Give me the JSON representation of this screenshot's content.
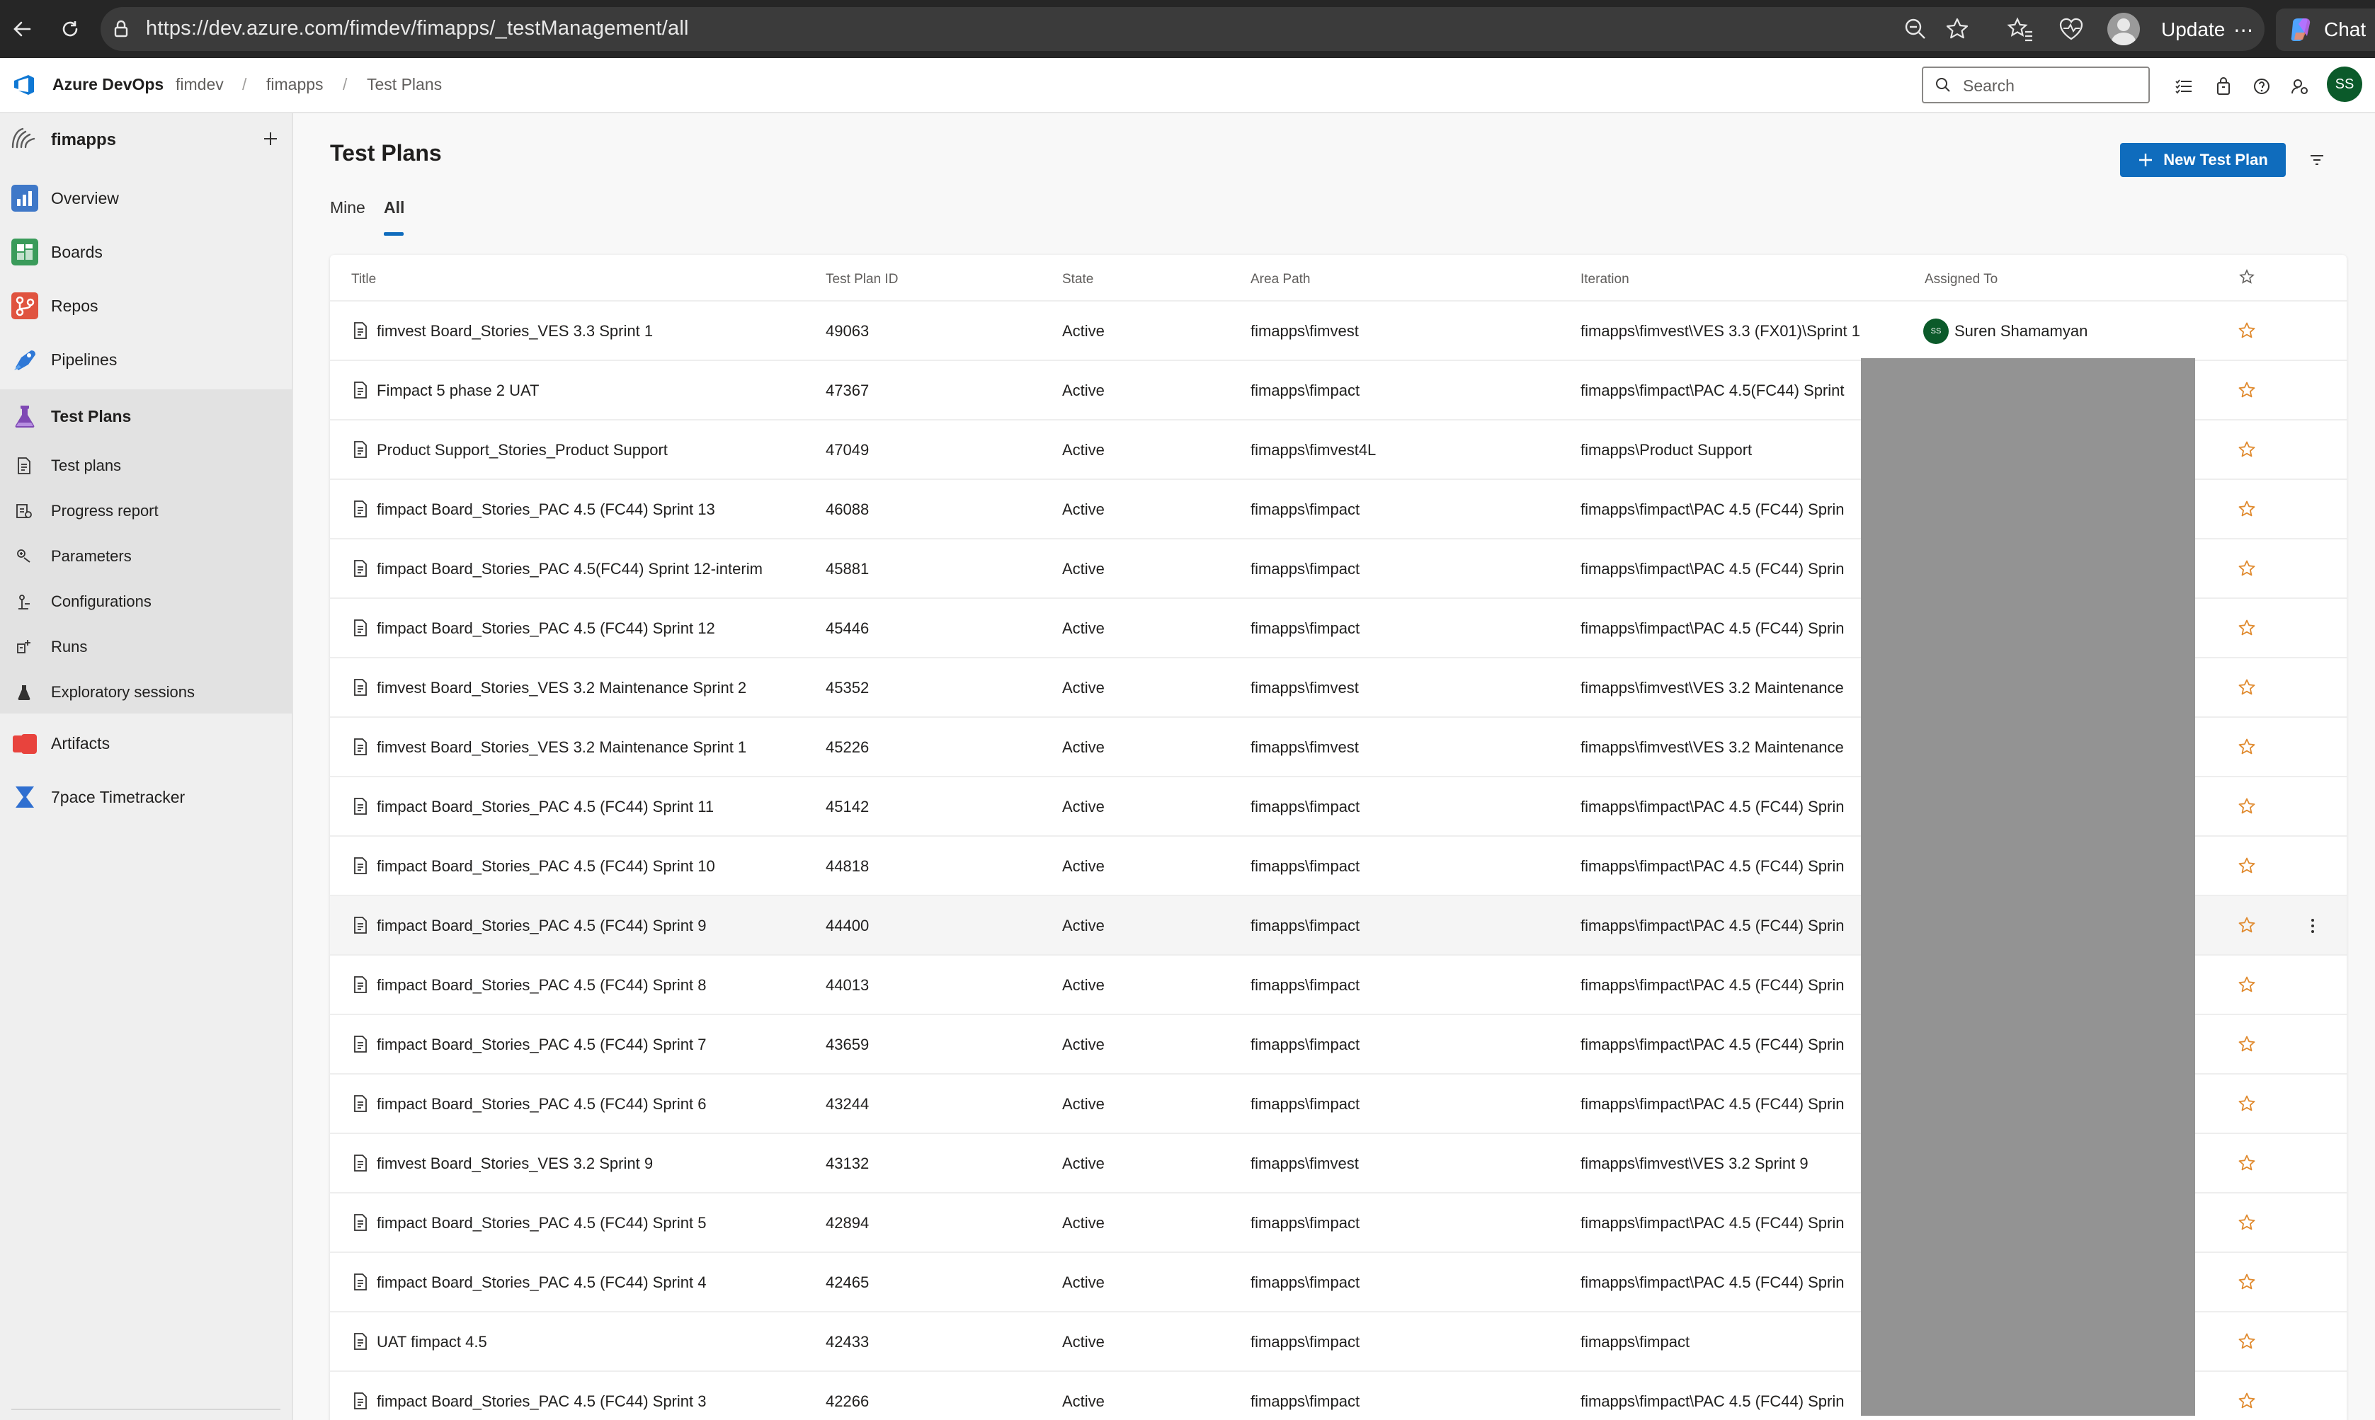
{
  "browser": {
    "url": "https://dev.azure.com/fimdev/fimapps/_testManagement/all",
    "update_label": "Update",
    "chat_label": "Chat"
  },
  "header": {
    "brand": "Azure DevOps",
    "breadcrumb": [
      "fimdev",
      "fimapps",
      "Test Plans"
    ],
    "search_placeholder": "Search",
    "avatar_initials": "SS"
  },
  "sidebar": {
    "project": "fimapps",
    "items": [
      {
        "label": "Overview",
        "icon": "overview-icon",
        "color": "#3f78c8"
      },
      {
        "label": "Boards",
        "icon": "boards-icon",
        "color": "#3a9b5a"
      },
      {
        "label": "Repos",
        "icon": "repos-icon",
        "color": "#e0533f"
      },
      {
        "label": "Pipelines",
        "icon": "pipelines-icon",
        "color": "#2f78d6"
      },
      {
        "label": "Test Plans",
        "icon": "test-plans-icon",
        "color": "#7f49b4"
      }
    ],
    "sub_items": [
      {
        "label": "Test plans",
        "icon": "test-plan-doc-icon"
      },
      {
        "label": "Progress report",
        "icon": "progress-report-icon"
      },
      {
        "label": "Parameters",
        "icon": "parameters-icon"
      },
      {
        "label": "Configurations",
        "icon": "configurations-icon"
      },
      {
        "label": "Runs",
        "icon": "runs-icon"
      },
      {
        "label": "Exploratory sessions",
        "icon": "exploratory-icon"
      }
    ],
    "extra_items": [
      {
        "label": "Artifacts",
        "icon": "artifacts-icon",
        "color": "#e8433d"
      },
      {
        "label": "7pace Timetracker",
        "icon": "timetracker-icon",
        "color": "#2f6fd0"
      }
    ]
  },
  "main": {
    "title": "Test Plans",
    "new_button": "New Test Plan",
    "tabs": [
      "Mine",
      "All"
    ],
    "active_tab": "All",
    "columns": [
      "Title",
      "Test Plan ID",
      "State",
      "Area Path",
      "Iteration",
      "Assigned To"
    ],
    "rows": [
      {
        "title": "fimvest Board_Stories_VES 3.3 Sprint 1",
        "id": "49063",
        "state": "Active",
        "area": "fimapps\\fimvest",
        "iteration": "fimapps\\fimvest\\VES 3.3 (FX01)\\Sprint 1",
        "assigned": "Suren Shamamyan",
        "assigned_initials": "SS"
      },
      {
        "title": "Fimpact 5 phase 2 UAT",
        "id": "47367",
        "state": "Active",
        "area": "fimapps\\fimpact",
        "iteration": "fimapps\\fimpact\\PAC 4.5(FC44) Sprint",
        "assigned": "",
        "assigned_initials": ""
      },
      {
        "title": "Product Support_Stories_Product Support",
        "id": "47049",
        "state": "Active",
        "area": "fimapps\\fimvest4L",
        "iteration": "fimapps\\Product Support",
        "assigned": "",
        "assigned_initials": ""
      },
      {
        "title": "fimpact Board_Stories_PAC 4.5 (FC44) Sprint 13",
        "id": "46088",
        "state": "Active",
        "area": "fimapps\\fimpact",
        "iteration": "fimapps\\fimpact\\PAC 4.5 (FC44) Sprin",
        "assigned": "",
        "assigned_initials": ""
      },
      {
        "title": "fimpact Board_Stories_PAC 4.5(FC44) Sprint 12-interim",
        "id": "45881",
        "state": "Active",
        "area": "fimapps\\fimpact",
        "iteration": "fimapps\\fimpact\\PAC 4.5 (FC44) Sprin",
        "assigned": "",
        "assigned_initials": ""
      },
      {
        "title": "fimpact Board_Stories_PAC 4.5 (FC44) Sprint 12",
        "id": "45446",
        "state": "Active",
        "area": "fimapps\\fimpact",
        "iteration": "fimapps\\fimpact\\PAC 4.5 (FC44) Sprin",
        "assigned": "",
        "assigned_initials": ""
      },
      {
        "title": "fimvest Board_Stories_VES 3.2 Maintenance Sprint 2",
        "id": "45352",
        "state": "Active",
        "area": "fimapps\\fimvest",
        "iteration": "fimapps\\fimvest\\VES 3.2 Maintenance",
        "assigned": "",
        "assigned_initials": ""
      },
      {
        "title": "fimvest Board_Stories_VES 3.2 Maintenance Sprint 1",
        "id": "45226",
        "state": "Active",
        "area": "fimapps\\fimvest",
        "iteration": "fimapps\\fimvest\\VES 3.2 Maintenance",
        "assigned": "",
        "assigned_initials": ""
      },
      {
        "title": "fimpact Board_Stories_PAC 4.5 (FC44) Sprint 11",
        "id": "45142",
        "state": "Active",
        "area": "fimapps\\fimpact",
        "iteration": "fimapps\\fimpact\\PAC 4.5 (FC44) Sprin",
        "assigned": "",
        "assigned_initials": ""
      },
      {
        "title": "fimpact Board_Stories_PAC 4.5 (FC44) Sprint 10",
        "id": "44818",
        "state": "Active",
        "area": "fimapps\\fimpact",
        "iteration": "fimapps\\fimpact\\PAC 4.5 (FC44) Sprin",
        "assigned": "",
        "assigned_initials": ""
      },
      {
        "title": "fimpact Board_Stories_PAC 4.5 (FC44) Sprint 9",
        "id": "44400",
        "state": "Active",
        "area": "fimapps\\fimpact",
        "iteration": "fimapps\\fimpact\\PAC 4.5 (FC44) Sprin",
        "assigned": "",
        "assigned_initials": "",
        "hovered": true
      },
      {
        "title": "fimpact Board_Stories_PAC 4.5 (FC44) Sprint 8",
        "id": "44013",
        "state": "Active",
        "area": "fimapps\\fimpact",
        "iteration": "fimapps\\fimpact\\PAC 4.5 (FC44) Sprin",
        "assigned": "",
        "assigned_initials": ""
      },
      {
        "title": "fimpact Board_Stories_PAC 4.5 (FC44) Sprint 7",
        "id": "43659",
        "state": "Active",
        "area": "fimapps\\fimpact",
        "iteration": "fimapps\\fimpact\\PAC 4.5 (FC44) Sprin",
        "assigned": "",
        "assigned_initials": ""
      },
      {
        "title": "fimpact Board_Stories_PAC 4.5 (FC44) Sprint 6",
        "id": "43244",
        "state": "Active",
        "area": "fimapps\\fimpact",
        "iteration": "fimapps\\fimpact\\PAC 4.5 (FC44) Sprin",
        "assigned": "",
        "assigned_initials": ""
      },
      {
        "title": "fimvest Board_Stories_VES 3.2 Sprint 9",
        "id": "43132",
        "state": "Active",
        "area": "fimapps\\fimvest",
        "iteration": "fimapps\\fimvest\\VES 3.2 Sprint 9",
        "assigned": "",
        "assigned_initials": ""
      },
      {
        "title": "fimpact Board_Stories_PAC 4.5 (FC44) Sprint 5",
        "id": "42894",
        "state": "Active",
        "area": "fimapps\\fimpact",
        "iteration": "fimapps\\fimpact\\PAC 4.5 (FC44) Sprin",
        "assigned": "",
        "assigned_initials": ""
      },
      {
        "title": "fimpact Board_Stories_PAC 4.5 (FC44) Sprint 4",
        "id": "42465",
        "state": "Active",
        "area": "fimapps\\fimpact",
        "iteration": "fimapps\\fimpact\\PAC 4.5 (FC44) Sprin",
        "assigned": "",
        "assigned_initials": ""
      },
      {
        "title": "UAT fimpact 4.5",
        "id": "42433",
        "state": "Active",
        "area": "fimapps\\fimpact",
        "iteration": "fimapps\\fimpact",
        "assigned": "",
        "assigned_initials": ""
      },
      {
        "title": "fimpact Board_Stories_PAC 4.5 (FC44) Sprint 3",
        "id": "42266",
        "state": "Active",
        "area": "fimapps\\fimpact",
        "iteration": "fimapps\\fimpact\\PAC 4.5 (FC44) Sprin",
        "assigned": "",
        "assigned_initials": ""
      }
    ]
  },
  "colors": {
    "accent": "#0f6cbd",
    "avatar_bg": "#0b5a2a",
    "star": "#e08a2e",
    "redaction": "#939393"
  }
}
